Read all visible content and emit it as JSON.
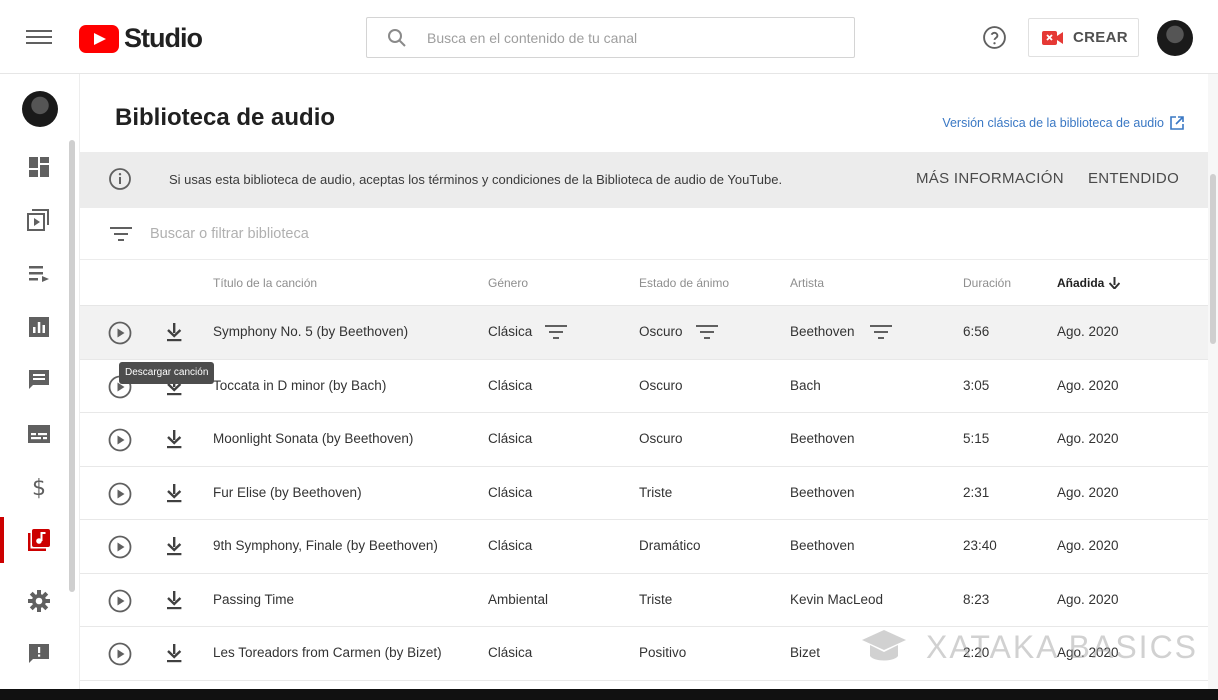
{
  "header": {
    "logo_text": "Studio",
    "search_placeholder": "Busca en el contenido de tu canal",
    "create_label": "CREAR"
  },
  "page": {
    "title": "Biblioteca de audio",
    "classic_link": "Versión clásica de la biblioteca de audio"
  },
  "banner": {
    "message": "Si usas esta biblioteca de audio, aceptas los términos y condiciones de la Biblioteca de audio de YouTube.",
    "more_info": "MÁS INFORMACIÓN",
    "dismiss": "ENTENDIDO"
  },
  "filter": {
    "placeholder": "Buscar o filtrar biblioteca"
  },
  "table": {
    "headers": {
      "title": "Título de la canción",
      "genre": "Género",
      "mood": "Estado de ánimo",
      "artist": "Artista",
      "duration": "Duración",
      "added": "Añadida"
    },
    "rows": [
      {
        "title": "Symphony No. 5 (by Beethoven)",
        "genre": "Clásica",
        "mood": "Oscuro",
        "artist": "Beethoven",
        "duration": "6:56",
        "added": "Ago. 2020"
      },
      {
        "title": "Toccata in D minor (by Bach)",
        "genre": "Clásica",
        "mood": "Oscuro",
        "artist": "Bach",
        "duration": "3:05",
        "added": "Ago. 2020"
      },
      {
        "title": "Moonlight Sonata (by Beethoven)",
        "genre": "Clásica",
        "mood": "Oscuro",
        "artist": "Beethoven",
        "duration": "5:15",
        "added": "Ago. 2020"
      },
      {
        "title": "Fur Elise (by Beethoven)",
        "genre": "Clásica",
        "mood": "Triste",
        "artist": "Beethoven",
        "duration": "2:31",
        "added": "Ago. 2020"
      },
      {
        "title": "9th Symphony, Finale (by Beethoven)",
        "genre": "Clásica",
        "mood": "Dramático",
        "artist": "Beethoven",
        "duration": "23:40",
        "added": "Ago. 2020"
      },
      {
        "title": "Passing Time",
        "genre": "Ambiental",
        "mood": "Triste",
        "artist": "Kevin MacLeod",
        "duration": "8:23",
        "added": "Ago. 2020"
      },
      {
        "title": "Les Toreadors from Carmen (by Bizet)",
        "genre": "Clásica",
        "mood": "Positivo",
        "artist": "Bizet",
        "duration": "2:20",
        "added": "Ago. 2020"
      }
    ]
  },
  "tooltip": "Descargar canción",
  "watermark": "XATAKA BASICS",
  "nav": {
    "items": [
      "dashboard-icon",
      "content-icon",
      "playlists-icon",
      "analytics-icon",
      "comments-icon",
      "subtitles-icon",
      "monetization-icon",
      "audio-library-icon",
      "settings-icon",
      "feedback-icon"
    ],
    "active": "audio-library-icon"
  },
  "colors": {
    "brand_red": "#ff0000",
    "active_red": "#cc0000",
    "link_blue": "#3a78c4",
    "banner_bg": "#ececec"
  }
}
